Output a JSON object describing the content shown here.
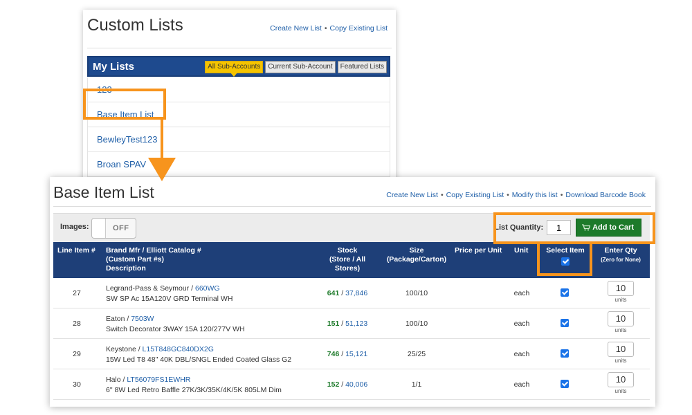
{
  "top_card": {
    "title": "Custom Lists",
    "actions": {
      "create_new": "Create New List",
      "copy_existing": "Copy Existing List",
      "separator": "•"
    },
    "my_lists_label": "My Lists",
    "tabs": [
      {
        "label": "All Sub-Accounts",
        "active": true
      },
      {
        "label": "Current Sub-Account",
        "active": false
      },
      {
        "label": "Featured Lists",
        "active": false
      }
    ],
    "items": [
      "123",
      "Base Item List",
      "BewleyTest123",
      "Broan SPAV",
      "..."
    ]
  },
  "bottom_card": {
    "title": "Base Item List",
    "actions": {
      "create_new": "Create New List",
      "copy_existing": "Copy Existing List",
      "modify": "Modify this list",
      "download": "Download Barcode Book",
      "separator": "•"
    },
    "toolbar": {
      "images_label": "Images:",
      "toggle_state": "OFF",
      "list_quantity_label": "List Quantity:",
      "list_quantity_value": "1",
      "add_to_cart_label": "Add to Cart"
    },
    "columns": {
      "line_item": "Line Item #",
      "brand_line1": "Brand Mfr / Elliott Catalog #",
      "brand_line2": "(Custom Part #s)",
      "brand_line3": "Description",
      "stock_line1": "Stock",
      "stock_line2": "(Store / All",
      "stock_line3": "Stores)",
      "size_line1": "Size",
      "size_line2": "(Package/Carton)",
      "price": "Price per Unit",
      "unit": "Unit",
      "select": "Select Item",
      "qty_line1": "Enter Qty",
      "qty_line2": "(Zero for None)"
    },
    "rows": [
      {
        "line": "27",
        "mfr": "Legrand-Pass & Seymour /",
        "part": "660WG",
        "desc": "SW SP Ac 15A120V GRD Terminal WH",
        "stock_store": "641",
        "stock_all": "37,846",
        "size": "100/10",
        "price": "",
        "unit": "each",
        "selected": true,
        "qty": "10",
        "qty_unit": "units"
      },
      {
        "line": "28",
        "mfr": "Eaton /",
        "part": "7503W",
        "desc": "Switch Decorator 3WAY 15A 120/277V WH",
        "stock_store": "151",
        "stock_all": "51,123",
        "size": "100/10",
        "price": "",
        "unit": "each",
        "selected": true,
        "qty": "10",
        "qty_unit": "units"
      },
      {
        "line": "29",
        "mfr": "Keystone /",
        "part": "L15T848GC840DX2G",
        "desc": "15W Led T8 48\" 40K DBL/SNGL Ended Coated Glass G2",
        "stock_store": "746",
        "stock_all": "15,121",
        "size": "25/25",
        "price": "",
        "unit": "each",
        "selected": true,
        "qty": "10",
        "qty_unit": "units"
      },
      {
        "line": "30",
        "mfr": "Halo /",
        "part": "LT56079FS1EWHR",
        "desc": "6\" 8W Led Retro Baffle 27K/3K/35K/4K/5K 805LM Dim",
        "stock_store": "152",
        "stock_all": "40,006",
        "size": "1/1",
        "price": "",
        "unit": "each",
        "selected": true,
        "qty": "10",
        "qty_unit": "units"
      }
    ],
    "stock_separator": "/"
  },
  "colors": {
    "highlight": "#f7941d",
    "header_blue": "#1e3f78",
    "link_blue": "#1f5fa8",
    "cart_green": "#1d7a2a",
    "tab_active": "#f5c400"
  }
}
